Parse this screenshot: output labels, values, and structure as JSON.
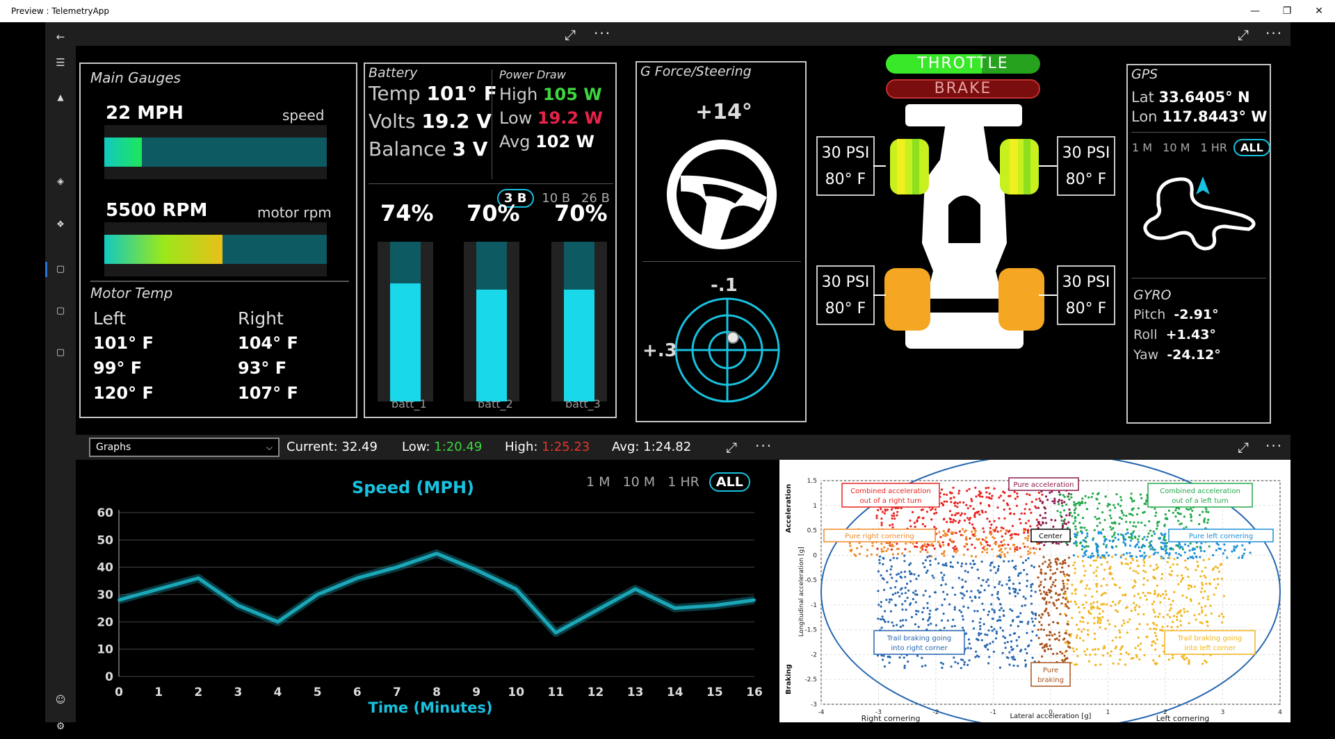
{
  "window": {
    "title": "Preview : TelemetryApp"
  },
  "main_gauges": {
    "title": "Main Gauges",
    "speed": {
      "value": "22 MPH",
      "label": "speed",
      "fill": 0.17
    },
    "rpm": {
      "value": "5500 RPM",
      "label": "motor rpm",
      "fill": 0.53
    },
    "motor_temp_title": "Motor Temp",
    "left_label": "Left",
    "right_label": "Right",
    "left_temps": [
      "101° F",
      "99° F",
      "120° F"
    ],
    "right_temps": [
      "104° F",
      "93° F",
      "107° F"
    ]
  },
  "battery": {
    "title": "Battery",
    "temp_label": "Temp",
    "temp_value": "101° F",
    "volts_label": "Volts",
    "volts_value": "19.2 V",
    "balance_label": "Balance",
    "balance_value": "3 V",
    "power_title": "Power Draw",
    "high_label": "High",
    "high_value": "105 W",
    "low_label": "Low",
    "low_value": "19.2 W",
    "avg_label": "Avg",
    "avg_value": "102 W",
    "range_buttons": [
      "3 B",
      "10 B",
      "26 B"
    ],
    "range_selected": "3 B",
    "cells": [
      {
        "name": "batt_1",
        "pct": "74%",
        "level": 0.74
      },
      {
        "name": "batt_2",
        "pct": "70%",
        "level": 0.7
      },
      {
        "name": "batt_3",
        "pct": "70%",
        "level": 0.7
      }
    ]
  },
  "gforce": {
    "title": "G Force/Steering",
    "steering_angle": "+14°",
    "g_long": "-.1",
    "g_lat": "+.3"
  },
  "car": {
    "throttle_label": "THROTTLE",
    "brake_label": "BRAKE",
    "throttle_level": 0.62,
    "tires": [
      {
        "pos": "front-left",
        "psi": "30 PSI",
        "temp": "80° F"
      },
      {
        "pos": "front-right",
        "psi": "30 PSI",
        "temp": "80° F"
      },
      {
        "pos": "rear-left",
        "psi": "30 PSI",
        "temp": "80° F"
      },
      {
        "pos": "rear-right",
        "psi": "30 PSI",
        "temp": "80° F"
      }
    ]
  },
  "gps": {
    "title": "GPS",
    "lat_label": "Lat",
    "lat_value": "33.6405° N",
    "lon_label": "Lon",
    "lon_value": "117.8443° W",
    "range_buttons": [
      "1 M",
      "10 M",
      "1 HR",
      "ALL"
    ],
    "range_selected": "ALL",
    "gyro_title": "GYRO",
    "pitch_label": "Pitch",
    "pitch_value": "-2.91°",
    "roll_label": "Roll",
    "roll_value": "+1.43°",
    "yaw_label": "Yaw",
    "yaw_value": "-24.12°"
  },
  "stats_bar": {
    "dropdown_value": "Graphs",
    "current_label": "Current:",
    "current_value": "32.49",
    "low_label": "Low:",
    "low_value": "1:20.49",
    "high_label": "High:",
    "high_value": "1:25.23",
    "avg_label": "Avg:",
    "avg_value": "1:24.82"
  },
  "speed_chart": {
    "range_buttons": [
      "1 M",
      "10 M",
      "1 HR",
      "ALL"
    ],
    "range_selected": "ALL"
  },
  "chart_data": {
    "type": "line",
    "title": "Speed (MPH)",
    "xlabel": "Time (Minutes)",
    "ylabel": "",
    "x": [
      0,
      1,
      2,
      3,
      4,
      5,
      6,
      7,
      8,
      9,
      10,
      11,
      12,
      13,
      14,
      15,
      16
    ],
    "series": [
      {
        "values": [
          28,
          32,
          36,
          26,
          20,
          30,
          36,
          40,
          45,
          39,
          32,
          16,
          24,
          32,
          25,
          26,
          28
        ]
      }
    ],
    "xlim": [
      0,
      16
    ],
    "ylim": [
      0,
      60
    ],
    "yticks": [
      0,
      10,
      20,
      30,
      40,
      50,
      60
    ],
    "grid": true,
    "color": "#1aa7b8"
  },
  "gg_diagram": {
    "x_label": "Lateral acceleration [g]",
    "y_label": "Longitudinal acceleration [g]",
    "accel_label": "Acceleration",
    "braking_label": "Braking",
    "right_cornering": "Right cornering",
    "left_cornering": "Left cornering",
    "x_ticks": [
      "-4",
      "-3",
      "-2",
      "-1",
      "0",
      "1",
      "2",
      "3",
      "4"
    ],
    "y_ticks": [
      "1.5",
      "1",
      "0.5",
      "0",
      "-0.5",
      "-1",
      "-1.5",
      "-2",
      "-2.5",
      "-3"
    ],
    "regions": [
      {
        "key": "comb_right",
        "text1": "Combined acceleration",
        "text2": "out of a right turn",
        "color": "#e8221f"
      },
      {
        "key": "pure_accel",
        "text1": "Pure acceleration",
        "text2": "",
        "color": "#8b1a4a"
      },
      {
        "key": "comb_left",
        "text1": "Combined acceleration",
        "text2": "out of a left turn",
        "color": "#22a84a"
      },
      {
        "key": "pure_right",
        "text1": "Pure right cornering",
        "text2": "",
        "color": "#f08a28"
      },
      {
        "key": "center",
        "text1": "Center",
        "text2": "",
        "color": "#000000"
      },
      {
        "key": "pure_left",
        "text1": "Pure left cornering",
        "text2": "",
        "color": "#1b8fd6"
      },
      {
        "key": "trail_right",
        "text1": "Trail braking going",
        "text2": "into right corner",
        "color": "#2566b0"
      },
      {
        "key": "trail_left",
        "text1": "Trail braking going",
        "text2": "into left corner",
        "color": "#f3b41b"
      },
      {
        "key": "pure_brake",
        "text1": "Pure",
        "text2": "braking",
        "color": "#a8521c"
      }
    ]
  }
}
